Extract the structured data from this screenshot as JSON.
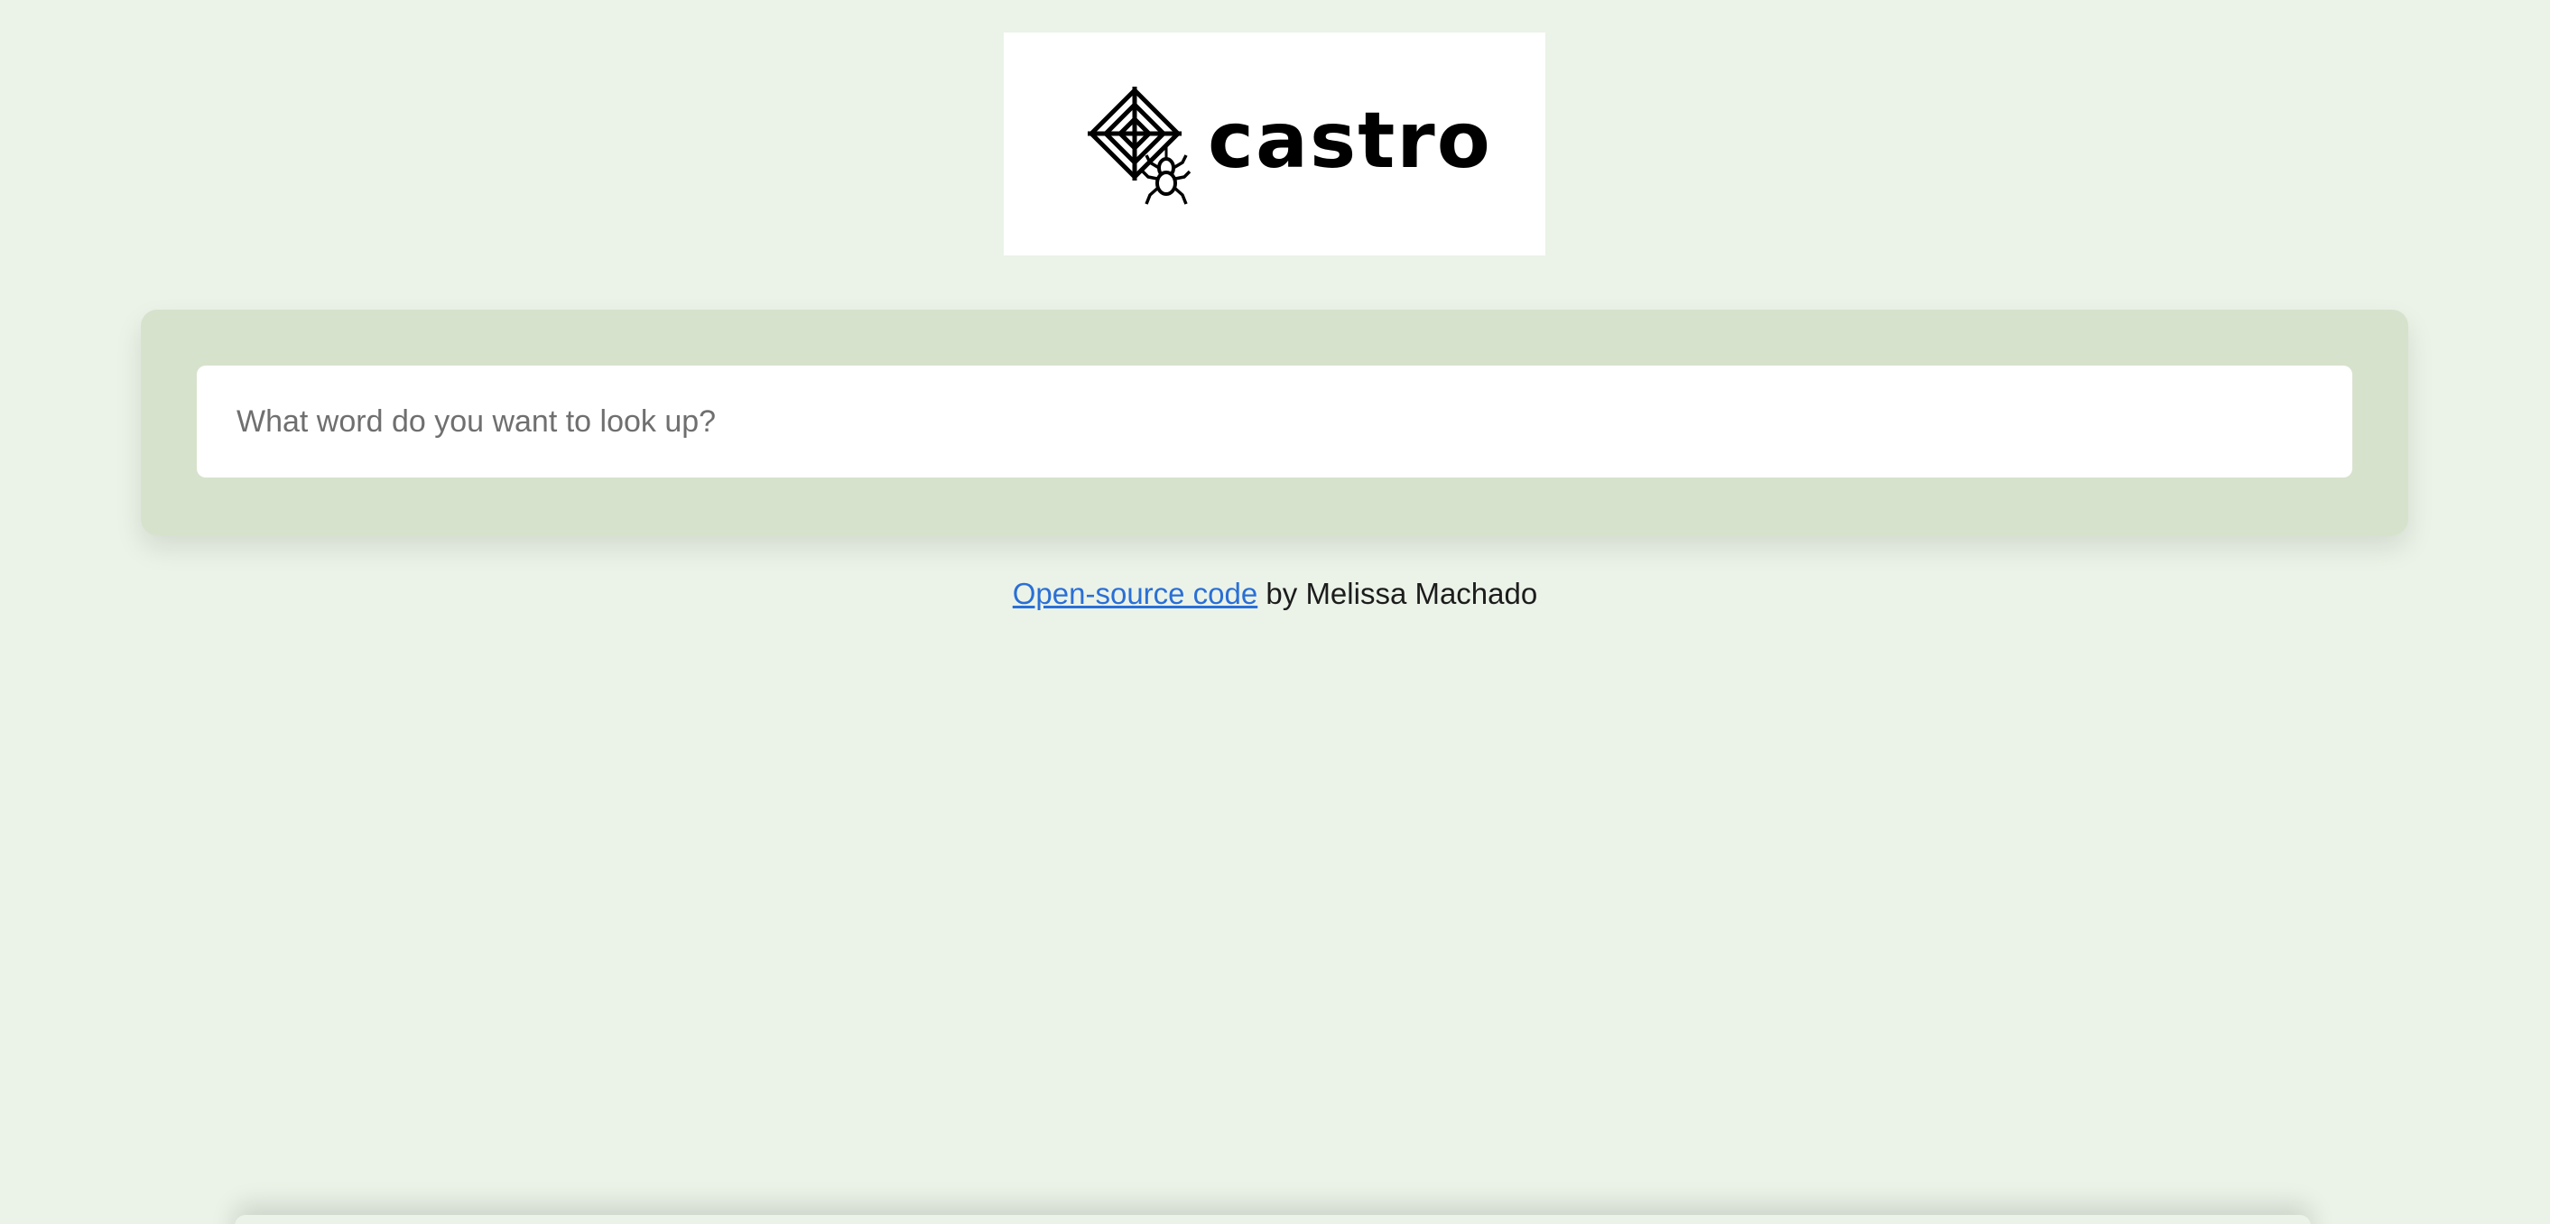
{
  "logo": {
    "text": "castro",
    "icon": "spider-web-icon"
  },
  "search": {
    "placeholder": "What word do you want to look up?",
    "value": ""
  },
  "footer": {
    "link_text": "Open-source code",
    "suffix_text": " by Melissa Machado"
  },
  "colors": {
    "background": "#ebf3e8",
    "panel": "#d7e2cd",
    "link": "#2a6fd6"
  }
}
